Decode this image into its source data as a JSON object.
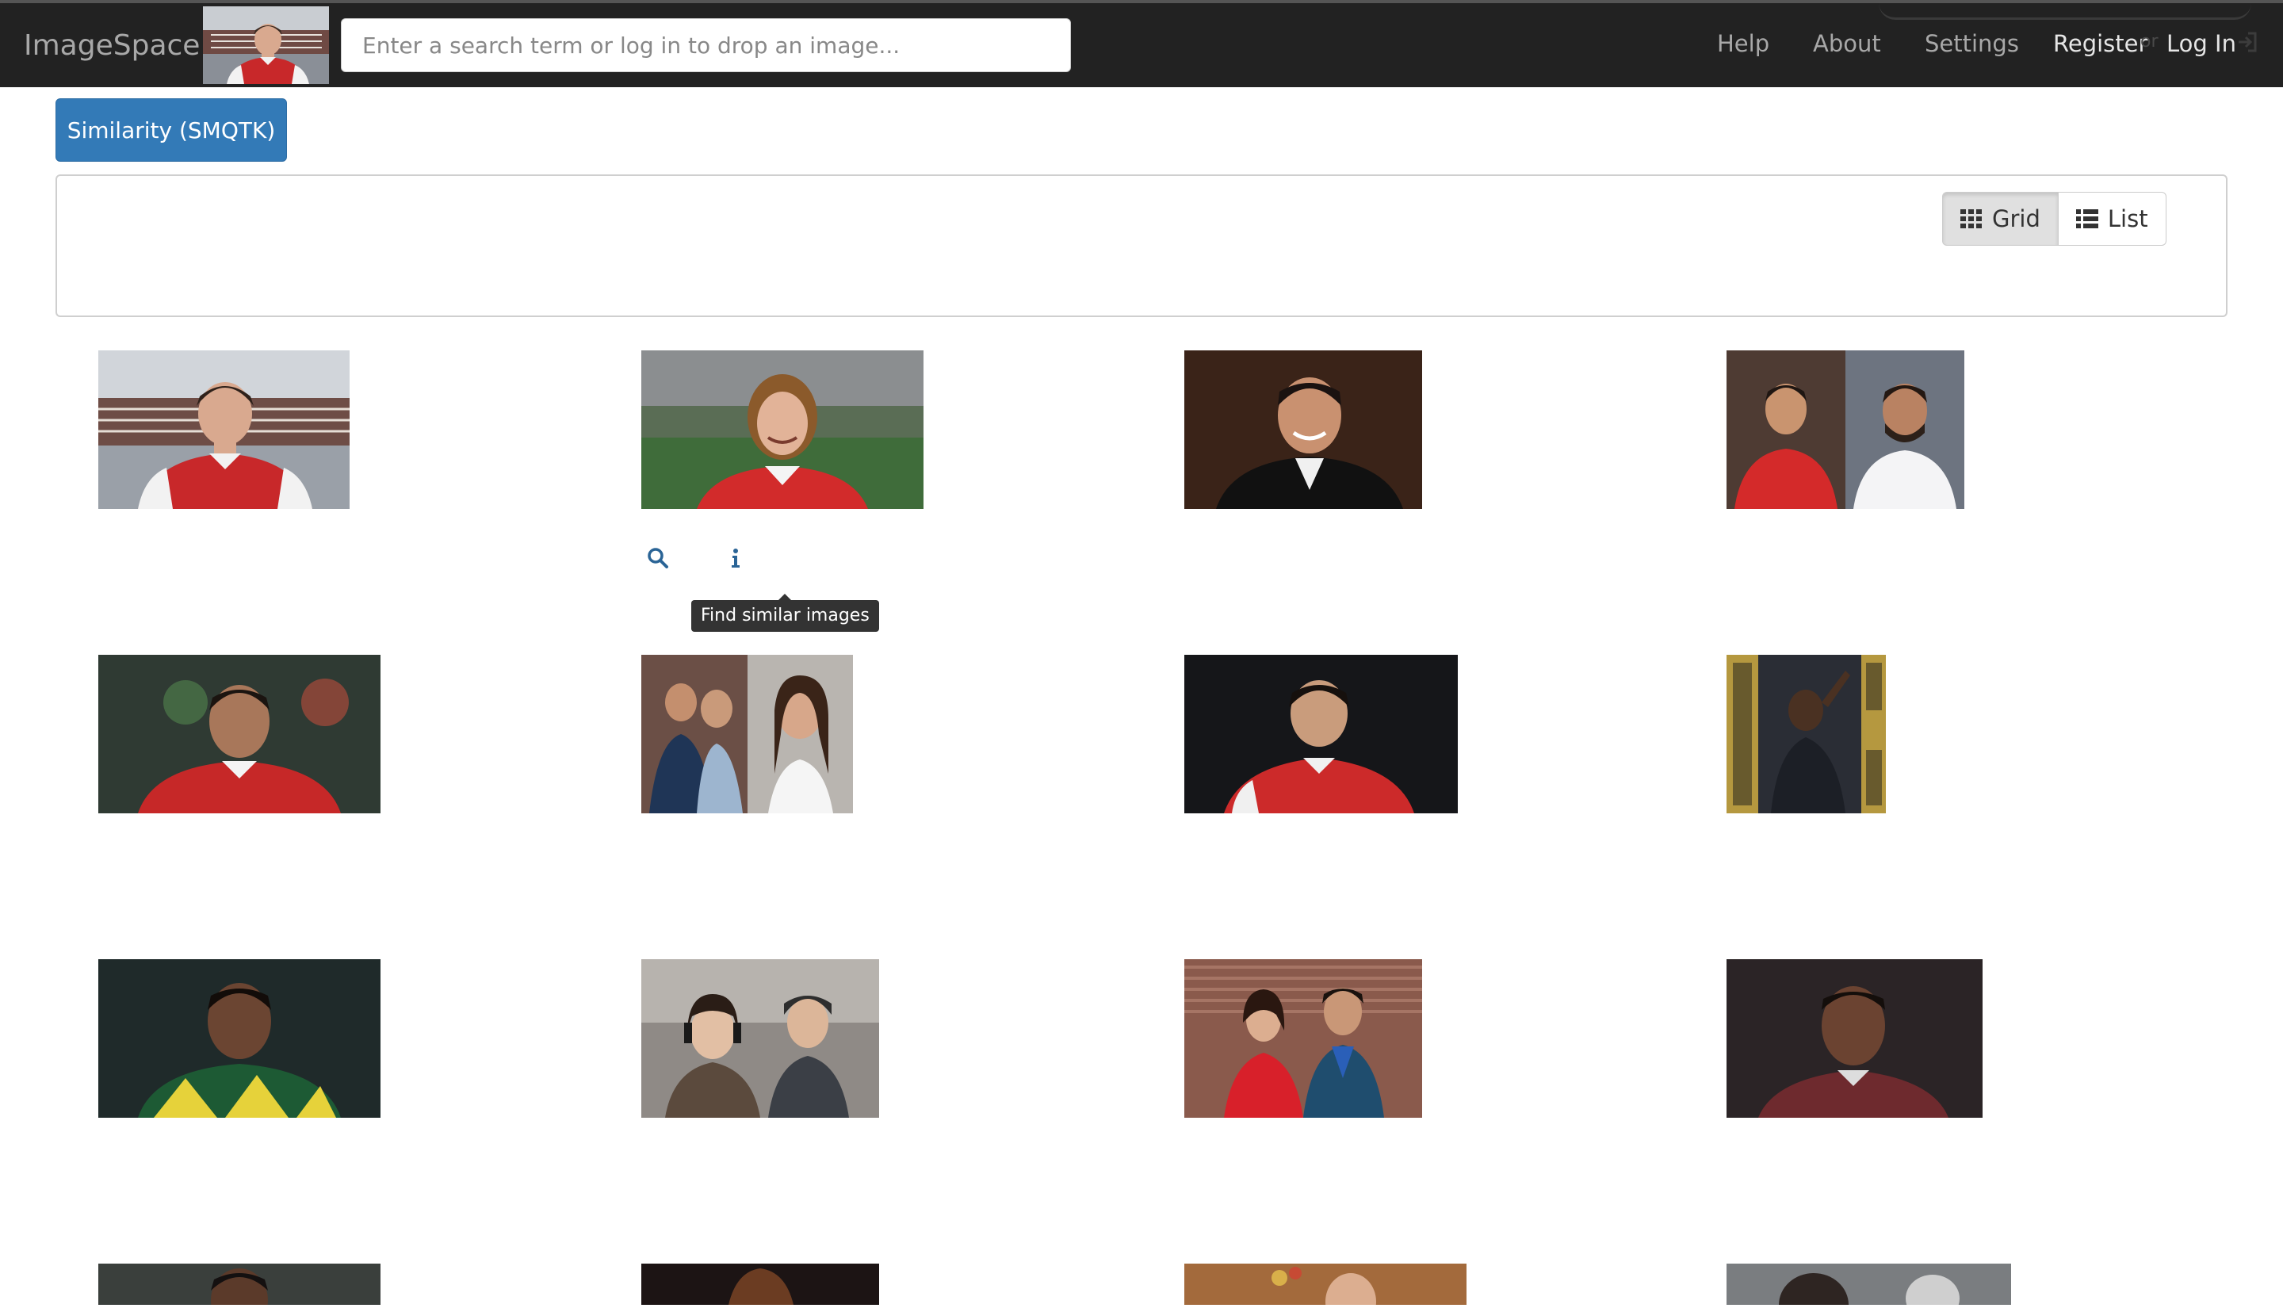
{
  "navbar": {
    "brand": "ImageSpace",
    "search_placeholder": "Enter a search term or log in to drop an image...",
    "links": {
      "help": "Help",
      "about": "About",
      "settings": "Settings",
      "register": "Register",
      "or": "or",
      "login": "Log In"
    },
    "login_icon": "sign-in-icon",
    "query_image_icon": "query-image-thumbnail"
  },
  "similarity_button": "Similarity (SMQTK)",
  "view_toggle": {
    "grid_label": "Grid",
    "list_label": "List",
    "grid_icon": "grid-icon",
    "list_icon": "list-icon",
    "active": "Grid"
  },
  "result_actions": {
    "find_similar_icon": "search-icon",
    "info_icon": "info-icon",
    "tooltip": "Find similar images"
  },
  "colors": {
    "navbar": "#222222",
    "primary": "#337ab7",
    "link": "#2a6496"
  }
}
